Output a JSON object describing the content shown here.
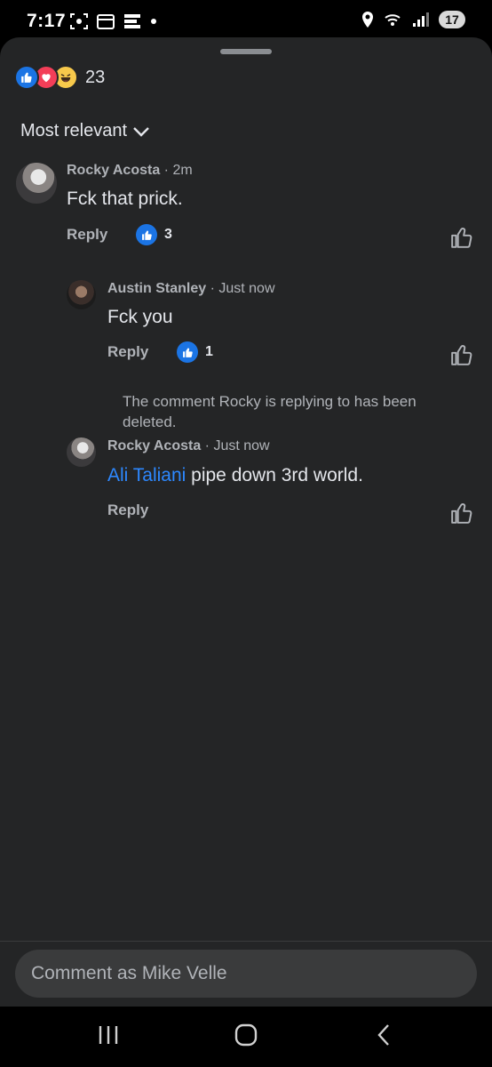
{
  "status_bar": {
    "time": "7:17",
    "battery": "17"
  },
  "reactions": {
    "count": "23",
    "icons": [
      "like-icon",
      "love-icon",
      "haha-icon"
    ]
  },
  "sort": {
    "label": "Most relevant"
  },
  "comments": [
    {
      "author": "Rocky Acosta",
      "time": " · 2m",
      "text": "Fck that prick.",
      "reply_label": "Reply",
      "like_count": "3"
    },
    {
      "author": "Austin Stanley",
      "time": " · Just now",
      "text": "Fck you",
      "reply_label": "Reply",
      "like_count": "1"
    },
    {
      "author": "Rocky Acosta",
      "time": " · Just now",
      "mention": "Ali Taliani",
      "text": " pipe down 3rd world.",
      "reply_label": "Reply"
    }
  ],
  "deleted_note": "The comment Rocky is replying to has been deleted.",
  "composer": {
    "placeholder": "Comment as Mike Velle"
  },
  "colors": {
    "sheet": "#242526",
    "accent": "#1b74e4",
    "mention": "#2d88ff"
  }
}
